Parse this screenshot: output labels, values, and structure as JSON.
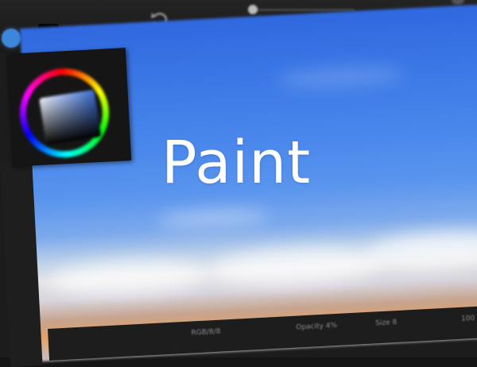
{
  "app": {
    "overlay_title": "Paint"
  },
  "toolbar": {
    "tools": [
      {
        "name": "color-dot",
        "icon": "color-swatch-icon"
      },
      {
        "name": "brush",
        "icon": "brush-icon"
      },
      {
        "name": "eraser",
        "icon": "eraser-icon"
      },
      {
        "name": "undo",
        "icon": "undo-icon"
      }
    ]
  },
  "color_picker": {
    "current_color": "#3b6fd6"
  },
  "status_bar": {
    "left": "RGB/8/8",
    "opacity": "Opacity 4%",
    "size": "Size 8",
    "zoom": "100"
  },
  "colors": {
    "accent": "#3d86d9",
    "toolbar_bg": "#1c1c1c",
    "sky_top": "#3068df",
    "sky_bottom": "#7eaaec",
    "cloud": "#e4e4e7",
    "sunset": "#e2a26a"
  }
}
